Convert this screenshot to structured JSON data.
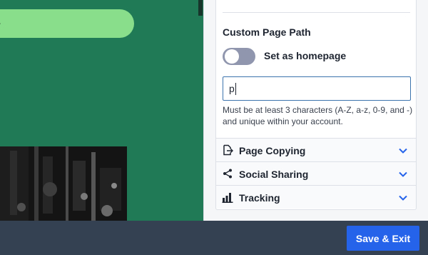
{
  "canvas": {
    "pill_glyph": "r"
  },
  "panel": {
    "section_title": "Custom Page Path",
    "homepage_toggle": {
      "label": "Set as homepage",
      "on": false
    },
    "path_input": {
      "value": "p"
    },
    "help_text": "Must be at least 3 characters (A-Z, a-z, 0-9, and -) and unique within your account.",
    "accordions": [
      {
        "label": "Page Copying",
        "icon": "page-export-icon"
      },
      {
        "label": "Social Sharing",
        "icon": "share-icon"
      },
      {
        "label": "Tracking",
        "icon": "bar-chart-icon"
      }
    ]
  },
  "footer": {
    "save_exit_label": "Save & Exit"
  },
  "colors": {
    "canvas_green": "#1f7a55",
    "pill_green": "#89de8b",
    "accent_blue": "#2563eb",
    "footer_bg": "#334152",
    "toggle_off": "#9096ad"
  }
}
